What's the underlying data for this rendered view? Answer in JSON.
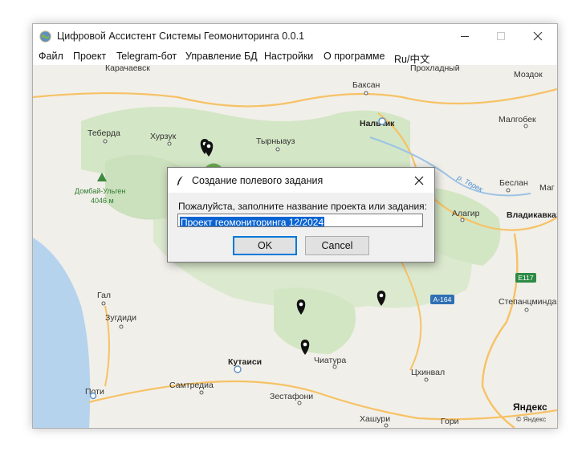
{
  "window": {
    "title": "Цифровой Ассистент Системы Геомониторинга 0.0.1",
    "icon": "globe-icon",
    "controls": [
      "minimize-icon",
      "maximize-icon",
      "close-icon"
    ]
  },
  "menu": [
    "Файл",
    "Проект",
    "Telegram-бот",
    "Управление БД",
    "Настройки",
    "О программе",
    "Ru/中文"
  ],
  "map": {
    "places": [
      "Карачаевск",
      "Прохладный",
      "Моздок",
      "Баксан",
      "Нальчик",
      "Теберда",
      "Хурзук",
      "Тырныауз",
      "Малгобек",
      "Домбай-Ульген",
      "4046 м",
      "Беслан",
      "Маг",
      "Алагир",
      "Владикавказ",
      "Гал",
      "Зугдиди",
      "Кутаиси",
      "Чиатура",
      "Самтредиа",
      "Поти",
      "Зестафони",
      "Цхинвал",
      "Хашури",
      "Гори",
      "Степанцминда"
    ],
    "river": "р. Терек",
    "roads": [
      "E117",
      "A-164"
    ],
    "brand": "Яндекс",
    "copyright": "© Яндекс",
    "colors": {
      "water": "#b6d3ee",
      "land": "#f1efe9",
      "forest": "#cfe4c1",
      "road": "#f6c266",
      "marker": "#111111"
    }
  },
  "dialog": {
    "title": "Создание полевого задания",
    "prompt": "Пожалуйста, заполните название проекта или задания:",
    "input_value": "Проект геомониторинга 12/2024",
    "ok_label": "OK",
    "cancel_label": "Cancel"
  }
}
